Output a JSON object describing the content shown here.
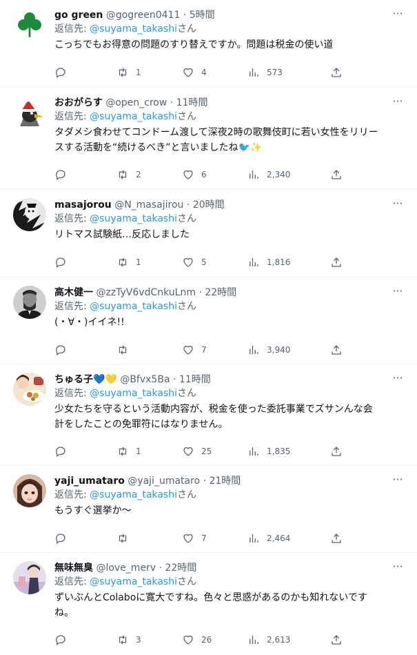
{
  "reply_prefix": "返信先: ",
  "reply_suffix": "さん",
  "tweets": [
    {
      "name": "go green",
      "handle": "@gogreen0411",
      "dot": "·",
      "time": "5時間",
      "reply_to": "@suyama_takashi",
      "lines": [
        "こっちでもお得意の問題のすり替えですか。問題は税金の使い道"
      ],
      "replies": "",
      "retweets": "1",
      "likes": "4",
      "views": "573",
      "avatar": "clover"
    },
    {
      "name": "おおがらす",
      "handle": "@open_crow",
      "dot": "·",
      "time": "11時間",
      "reply_to": "@suyama_takashi",
      "lines": [
        "タダメシ食わせてコンドーム渡して深夜2時の歌舞伎町に若い女性をリリー",
        "スする活動を“続けるべき”と言いましたね🐦✨"
      ],
      "replies": "",
      "retweets": "2",
      "likes": "6",
      "views": "2,340",
      "avatar": "crow"
    },
    {
      "name": "masajorou",
      "handle": "@N_masajirou",
      "dot": "·",
      "time": "20時間",
      "reply_to": "@suyama_takashi",
      "lines": [
        "リトマス試験紙…反応しました"
      ],
      "replies": "",
      "retweets": "1",
      "likes": "5",
      "views": "1,816",
      "avatar": "bw"
    },
    {
      "name": "高木健一",
      "handle": "@zzTyV6vdCnkuLnm",
      "dot": "·",
      "time": "22時間",
      "reply_to": "@suyama_takashi",
      "lines": [
        "(・∀・)イイネ!!"
      ],
      "replies": "",
      "retweets": "",
      "likes": "7",
      "views": "3,940",
      "avatar": "lincoln"
    },
    {
      "name": "ちゅる子💙💛",
      "handle": "@Bfvx5Ba",
      "dot": "·",
      "time": "11時間",
      "reply_to": "@suyama_takashi",
      "lines": [
        "少女たちを守るという活動内容が、税金を使った委託事業でズサンんな会",
        "計をしたことの免罪符にはなりません。"
      ],
      "replies": "",
      "retweets": "1",
      "likes": "25",
      "views": "1,835",
      "avatar": "food"
    },
    {
      "name": "yaji_umataro",
      "handle": "@yaji_umataro",
      "dot": "·",
      "time": "21時間",
      "reply_to": "@suyama_takashi",
      "lines": [
        "もうすぐ選挙か〜"
      ],
      "replies": "",
      "retweets": "",
      "likes": "7",
      "views": "2,464",
      "avatar": "girl"
    },
    {
      "name": "無味無臭",
      "handle": "@love_merv",
      "dot": "·",
      "time": "22時間",
      "reply_to": "@suyama_takashi",
      "lines": [
        "ずいぶんとColaboに寛大ですね。色々と思惑があるのかも知れないです",
        "ね。"
      ],
      "replies": "",
      "retweets": "3",
      "likes": "26",
      "views": "2,613",
      "avatar": "anime"
    }
  ],
  "colors": {
    "link": "#1d9bf0",
    "muted": "#536471",
    "text": "#0f1419",
    "divider": "#eff3f4"
  },
  "icons": [
    "more-icon",
    "reply-icon",
    "retweet-icon",
    "like-icon",
    "views-icon",
    "share-icon"
  ]
}
